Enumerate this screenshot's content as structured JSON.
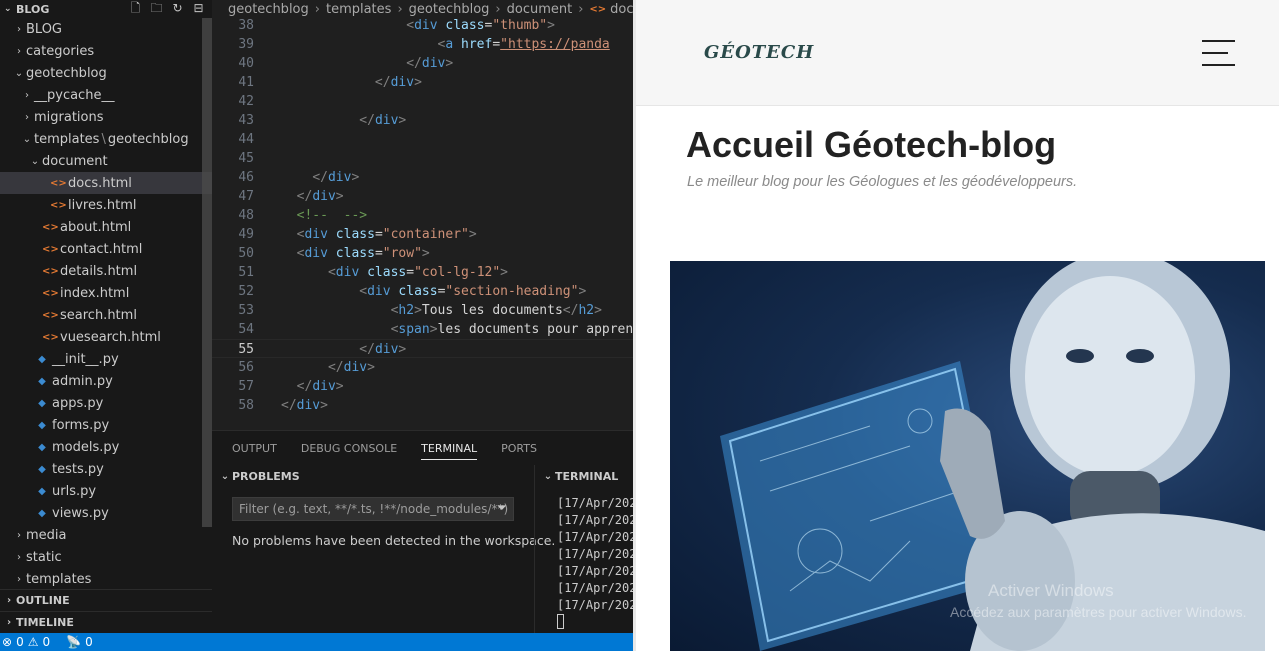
{
  "explorer": {
    "title": "BLOG",
    "tree": [
      {
        "label": "BLOG",
        "type": "folder",
        "expanded": false
      },
      {
        "label": "categories",
        "type": "folder",
        "expanded": false
      },
      {
        "label": "geotechblog",
        "type": "folder",
        "expanded": true
      },
      {
        "label": "__pycache__",
        "type": "folder",
        "expanded": false
      },
      {
        "label": "migrations",
        "type": "folder",
        "expanded": false
      },
      {
        "label": "templates",
        "label2": "geotechblog",
        "type": "folder",
        "expanded": true
      },
      {
        "label": "document",
        "type": "folder",
        "expanded": true
      },
      {
        "label": "docs.html",
        "type": "html",
        "selected": true
      },
      {
        "label": "livres.html",
        "type": "html"
      },
      {
        "label": "about.html",
        "type": "html"
      },
      {
        "label": "contact.html",
        "type": "html"
      },
      {
        "label": "details.html",
        "type": "html"
      },
      {
        "label": "index.html",
        "type": "html"
      },
      {
        "label": "search.html",
        "type": "html"
      },
      {
        "label": "vuesearch.html",
        "type": "html"
      },
      {
        "label": "__init__.py",
        "type": "py"
      },
      {
        "label": "admin.py",
        "type": "py"
      },
      {
        "label": "apps.py",
        "type": "py"
      },
      {
        "label": "forms.py",
        "type": "py"
      },
      {
        "label": "models.py",
        "type": "py"
      },
      {
        "label": "tests.py",
        "type": "py"
      },
      {
        "label": "urls.py",
        "type": "py"
      },
      {
        "label": "views.py",
        "type": "py"
      },
      {
        "label": "media",
        "type": "folder",
        "expanded": false
      },
      {
        "label": "static",
        "type": "folder",
        "expanded": false
      },
      {
        "label": "templates",
        "type": "folder",
        "expanded": false
      }
    ],
    "outline_label": "OUTLINE",
    "timeline_label": "TIMELINE"
  },
  "editor": {
    "breadcrumb": [
      "geotechblog",
      "templates",
      "geotechblog",
      "document",
      "docs.html"
    ],
    "active_line": "55"
  },
  "panel": {
    "tabs": [
      "OUTPUT",
      "DEBUG CONSOLE",
      "TERMINAL",
      "PORTS"
    ],
    "active_tab": "TERMINAL",
    "problems_title": "PROBLEMS",
    "filter_placeholder": "Filter (e.g. text, **/*.ts, !**/node_modules/**)",
    "no_problems": "No problems have been detected in the workspace.",
    "terminal_title": "TERMINAL",
    "terminal_lines": [
      "[17/Apr/202",
      "[17/Apr/202",
      "[17/Apr/202",
      "[17/Apr/202",
      "[17/Apr/202",
      "[17/Apr/202",
      "[17/Apr/202"
    ]
  },
  "statusbar": {
    "errors": "0",
    "warnings": "0",
    "ports": "0"
  },
  "preview": {
    "logo": "GÉOTECH",
    "title": "Accueil Géotech-blog",
    "subtitle": "Le meilleur blog pour les Géologues et les géodéveloppeurs.",
    "watermark_line1": "Activer Windows",
    "watermark_line2": "Accédez aux paramètres pour activer Windows."
  },
  "colors": {
    "status_bar": "#0078d4",
    "html_icon": "#e37933",
    "py_icon": "#3b8bd1",
    "tag": "#569cd6",
    "attribute": "#9cdcfe",
    "string": "#ce9178",
    "comment": "#6a9955"
  }
}
